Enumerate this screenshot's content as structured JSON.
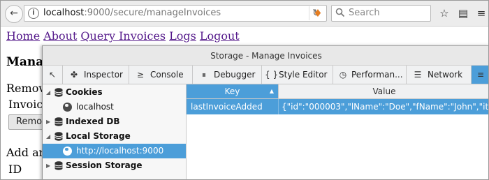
{
  "browser": {
    "url_host": "localhost",
    "url_rest": ":9000/secure/manageInvoices",
    "search_placeholder": "Search",
    "back_icon": "←",
    "reload_icon": "↻",
    "bookmark_icon": "☆",
    "library_icon": "▤",
    "menu_icon": "≡",
    "extension_icon": "♦",
    "info_icon": "i"
  },
  "page": {
    "nav": [
      "Home",
      "About",
      "Query Invoices",
      "Logs",
      "Logout"
    ],
    "heading_partial": "Mana",
    "remove_partial": "Remov",
    "invoice_partial": "Invoice",
    "button_partial": "Remo",
    "add_partial": "Add ar",
    "id_label": "ID"
  },
  "devtools": {
    "window_title": "Storage - Manage Invoices",
    "tabs": [
      {
        "icon": "↖",
        "label": ""
      },
      {
        "icon": "✤",
        "label": "Inspector"
      },
      {
        "icon": "≥",
        "label": "Console"
      },
      {
        "icon": "⏸",
        "label": "Debugger"
      },
      {
        "icon": "{ }",
        "label": "Style Editor"
      },
      {
        "icon": "◷",
        "label": "Performan..."
      },
      {
        "icon": "☰",
        "label": "Network"
      },
      {
        "icon": "≡",
        "label": ""
      }
    ],
    "tree": [
      {
        "label": "Cookies",
        "bold": true,
        "expanded": true,
        "icon": "database-icon"
      },
      {
        "label": "localhost",
        "bold": false,
        "icon": "globe-icon"
      },
      {
        "label": "Indexed DB",
        "bold": true,
        "expanded": false,
        "icon": "database-icon"
      },
      {
        "label": "Local Storage",
        "bold": true,
        "expanded": true,
        "icon": "database-icon"
      },
      {
        "label": "http://localhost:9000",
        "bold": false,
        "selected": true,
        "icon": "globe-icon"
      },
      {
        "label": "Session Storage",
        "bold": true,
        "expanded": false,
        "icon": "database-icon"
      }
    ],
    "table": {
      "columns": [
        "Key",
        "Value"
      ],
      "sort_indicator": "▲",
      "rows": [
        {
          "key": "lastInvoiceAdded",
          "value": "{\"id\":\"000003\",\"lName\":\"Doe\",\"fName\":\"John\",\"ite..."
        }
      ]
    }
  },
  "colors": {
    "selection": "#4c9ed9",
    "link_visited": "#551a8b"
  }
}
